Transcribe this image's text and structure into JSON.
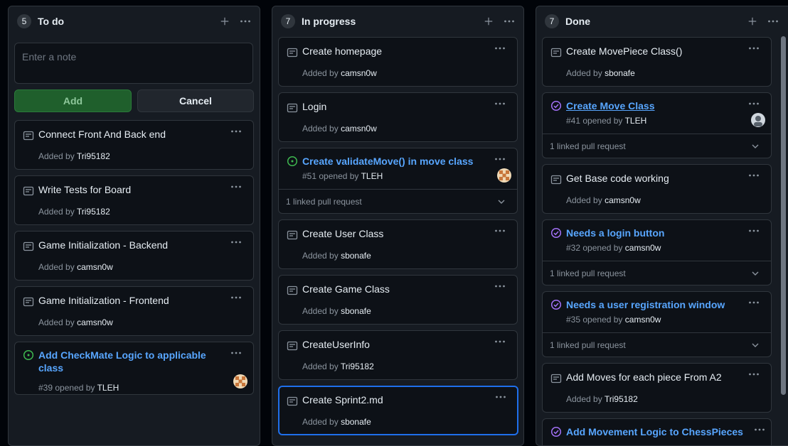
{
  "columns": [
    {
      "count": "5",
      "title": "To do",
      "note_placeholder": "Enter a note",
      "add_label": "Add",
      "cancel_label": "Cancel",
      "cards": [
        {
          "title": "Connect Front And Back end",
          "prefix": "Added by",
          "user": "Tri95182"
        },
        {
          "title": "Write Tests for Board",
          "prefix": "Added by",
          "user": "Tri95182"
        },
        {
          "title": "Game Initialization - Backend",
          "prefix": "Added by",
          "user": "camsn0w"
        },
        {
          "title": "Game Initialization - Frontend",
          "prefix": "Added by",
          "user": "camsn0w"
        },
        {
          "title_line1": "Add CheckMate Logic to applicable",
          "title_line2": "class",
          "number": "#39",
          "opened": "opened by",
          "user": "TLEH"
        }
      ]
    },
    {
      "count": "7",
      "title": "In progress",
      "cards": [
        {
          "title": "Create homepage",
          "prefix": "Added by",
          "user": "camsn0w"
        },
        {
          "title": "Login",
          "prefix": "Added by",
          "user": "camsn0w"
        },
        {
          "title": "Create validateMove() in move class",
          "number": "#51",
          "opened": "opened by",
          "user": "TLEH",
          "linked": "1 linked pull request"
        },
        {
          "title": "Create User Class",
          "prefix": "Added by",
          "user": "sbonafe"
        },
        {
          "title": "Create Game Class",
          "prefix": "Added by",
          "user": "sbonafe"
        },
        {
          "title": "CreateUserInfo",
          "prefix": "Added by",
          "user": "Tri95182"
        },
        {
          "title": "Create Sprint2.md",
          "prefix": "Added by",
          "user": "sbonafe"
        }
      ]
    },
    {
      "count": "7",
      "title": "Done",
      "cards": [
        {
          "title": "Create MovePiece Class()",
          "prefix": "Added by",
          "user": "sbonafe"
        },
        {
          "title": "Create Move Class",
          "number": "#41",
          "opened": "opened by",
          "user": "TLEH",
          "linked": "1 linked pull request"
        },
        {
          "title": "Get Base code working",
          "prefix": "Added by",
          "user": "camsn0w"
        },
        {
          "title": "Needs a login button",
          "number": "#32",
          "opened": "opened by",
          "user": "camsn0w",
          "linked": "1 linked pull request"
        },
        {
          "title": "Needs a user registration window",
          "number": "#35",
          "opened": "opened by",
          "user": "camsn0w",
          "linked": "1 linked pull request"
        },
        {
          "title": "Add Moves for each piece From A2",
          "prefix": "Added by",
          "user": "Tri95182"
        },
        {
          "title": "Add Movement Logic to ChessPieces"
        }
      ]
    }
  ],
  "colors": {
    "background": "#010409",
    "column": "#161b22",
    "card": "#0d1117",
    "border": "#30363d",
    "link": "#58a6ff",
    "open_issue": "#3fb950",
    "closed_issue": "#a371f7",
    "selected_border": "#1f6feb"
  },
  "icons": [
    "note-icon",
    "issue-open-icon",
    "issue-closed-icon",
    "plus-icon",
    "kebab-icon",
    "chevron-down-icon"
  ]
}
